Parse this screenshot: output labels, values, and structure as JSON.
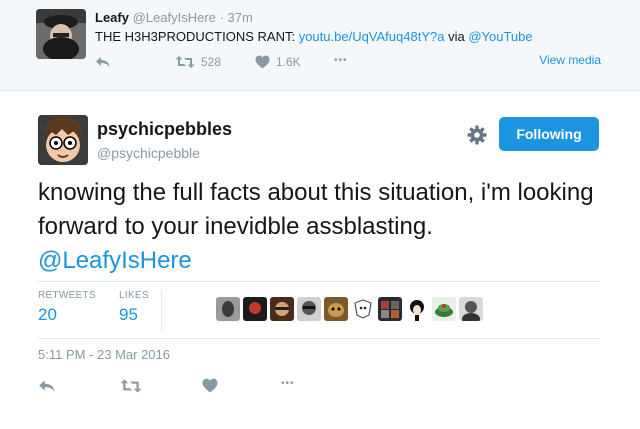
{
  "quoted_tweet": {
    "name": "Leafy",
    "handle": "@LeafyIsHere",
    "separator": "·",
    "time": "37m",
    "text_prefix": "THE H3H3PRODUCTIONS RANT:",
    "link": "youtu.be/UqVAfuq48tY?a",
    "via": "via",
    "via_account": "@YouTube",
    "retweet_count": "528",
    "like_count": "1.6K",
    "more": "•••",
    "view_media": "View media"
  },
  "tweet": {
    "name": "psychicpebbles",
    "handle": "@psychicpebble",
    "follow_label": "Following",
    "text": "knowing the full facts about this situation, i'm looking forward to your inevidble assblasting.",
    "mention": "@LeafyIsHere",
    "retweets_label": "RETWEETS",
    "retweets": "20",
    "likes_label": "LIKES",
    "likes": "95",
    "timestamp": "5:11 PM - 23 Mar 2016",
    "more": "•••"
  },
  "colors": {
    "accent": "#1b95e0",
    "muted": "#8899a6",
    "text": "#14171a",
    "border": "#e1e8ed",
    "top_bg": "#f5f8fa"
  },
  "icons": [
    "reply-icon",
    "retweet-icon",
    "heart-icon",
    "more-icon",
    "gear-icon"
  ]
}
